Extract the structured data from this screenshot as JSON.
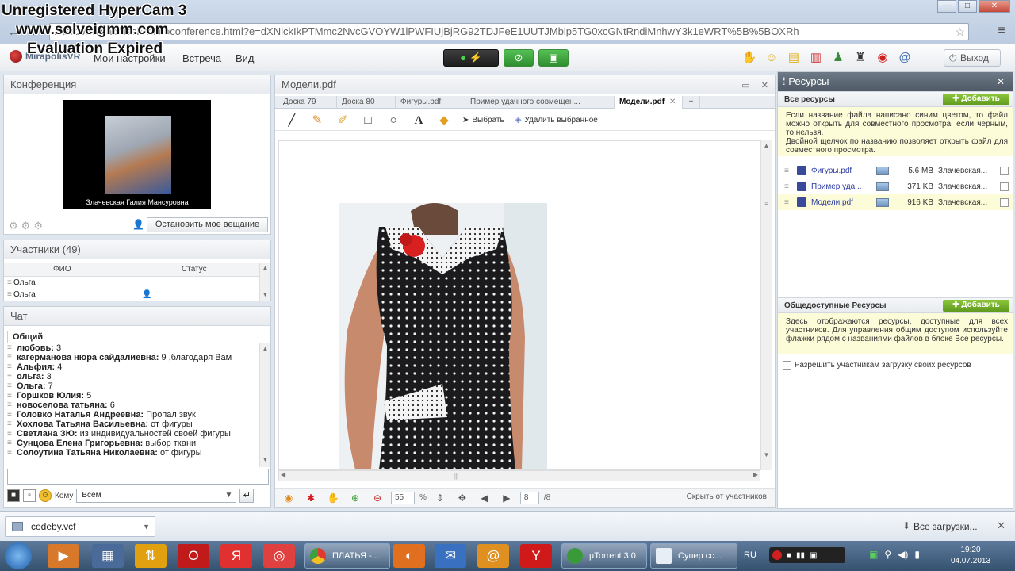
{
  "watermark": [
    "Unregistered HyperCam 3",
    "www.solveigmm.com",
    "Evaluation Expired"
  ],
  "browser": {
    "url_prefix": "",
    "url_host": "",
    "url_path": "/vfs/download/flash/videoconference.html?e=dXNlckIkPTMmc2NvcGVOYW1lPWFIUjBjRG92TDJFeE1UUTJMblp5TG0xcGNtRndiMnhwY3k1eWRT%5B%5BOXRh",
    "star": "☆",
    "menu": "≡",
    "win_min": "—",
    "win_max": "□",
    "win_close": "✕"
  },
  "app": {
    "logo_text": "MirapolisVR",
    "menu_settings": "Мои настройки",
    "menu_meeting": "Встреча",
    "menu_view": "Вид",
    "logout": "Выход"
  },
  "conference": {
    "title": "Конференция",
    "caption": "Злачевская Галия Мансуровна",
    "stop_button": "Остановить мое вещание"
  },
  "participants": {
    "title": "Участники (49)",
    "col_fio": "ФИО",
    "col_status": "Статус",
    "rows": [
      "Ольга",
      "Ольга"
    ]
  },
  "chat": {
    "title": "Чат",
    "tab": "Общий",
    "messages": [
      {
        "name": "любовь:",
        "text": " 3"
      },
      {
        "name": "кагерманова нюра сайдалиевна:",
        "text": " 9 ,благодаря Вам"
      },
      {
        "name": "Альфия:",
        "text": " 4"
      },
      {
        "name": "ольга:",
        "text": " 3"
      },
      {
        "name": "Ольга:",
        "text": " 7"
      },
      {
        "name": "Горшков Юлия:",
        "text": " 5"
      },
      {
        "name": "новоселова татьяна:",
        "text": " 6"
      },
      {
        "name": "Головко Наталья Андреевна:",
        "text": " Пропал звук"
      },
      {
        "name": "Хохлова Татьяна Васильевна:",
        "text": " от фигуры"
      },
      {
        "name": "Светлана ЗЮ:",
        "text": " из индивидуальностей своей фигуры"
      },
      {
        "name": "Сунцова Елена Григорьевна:",
        "text": " выбор ткани"
      },
      {
        "name": "Солоутина  Татьяна Николаевна:",
        "text": " от фигуры"
      }
    ],
    "to_label": "Кому",
    "to_value": "Всем"
  },
  "document": {
    "title": "Модели.pdf",
    "tabs": [
      "Доска 79",
      "Доска 80",
      "Фигуры.pdf",
      "Пример удачного совмещен...",
      "Модели.pdf"
    ],
    "tab_add": "+",
    "tab_close": "✕",
    "select_tool": "Выбрать",
    "delete_selected": "Удалить выбранное",
    "zoom": "55",
    "zoom_unit": "%",
    "page": "8",
    "page_total": "/8",
    "hide_link": "Скрыть от участников"
  },
  "resources": {
    "title": "Ресурсы",
    "all_title": "Все ресурсы",
    "add": "Добавить",
    "all_note": "Если название файла написано синим цветом, то файл можно открыть для совместного просмотра, если черным, то нельзя.\nДвойной щелчок по названию позволяет открыть файл для совместного просмотра.",
    "files": [
      {
        "name": "Фигуры.pdf",
        "size": "5.6 MB",
        "owner": "Злачевская..."
      },
      {
        "name": "Пример уда...",
        "size": "371 KB",
        "owner": "Злачевская..."
      },
      {
        "name": "Модели.pdf",
        "size": "916 KB",
        "owner": "Злачевская..."
      }
    ],
    "public_title": "Общедоступные Ресурсы",
    "public_note": "Здесь отображаются ресурсы, доступные для всех участников. Для управления общим доступом используйте флажки рядом с названиями файлов в блоке Все ресурсы.",
    "allow_upload": "Разрешить участникам загрузку своих ресурсов"
  },
  "downloads": {
    "file": "codeby.vcf",
    "all": "Все загрузки..."
  },
  "taskbar": {
    "task_chrome": "ПЛАТЬЯ -...",
    "task_utorrent": "µTorrent 3.0",
    "task_doc": "Супер сс...",
    "lang": "RU",
    "time": "19:20",
    "date": "04.07.2013"
  },
  "colors": {
    "accent_green": "#5f9a1e",
    "link_blue": "#2a3aa0",
    "note_yellow": "#fdfcd8"
  }
}
